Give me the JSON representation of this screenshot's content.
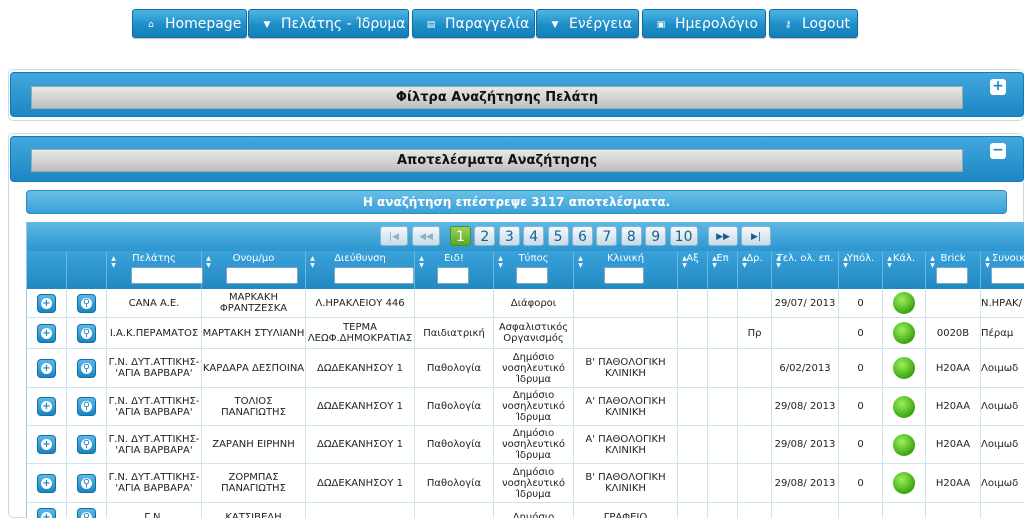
{
  "nav": [
    {
      "label": "Homepage",
      "icon": "home-icon",
      "glyph": "⌂"
    },
    {
      "label": "Πελάτης - Ίδρυμα",
      "icon": "dropdown-arrow-icon",
      "glyph": "▼"
    },
    {
      "label": "Παραγγελία",
      "icon": "list-icon",
      "glyph": "▤"
    },
    {
      "label": "Ενέργεια",
      "icon": "dropdown-arrow-icon",
      "glyph": "▼"
    },
    {
      "label": "Ημερολόγιο",
      "icon": "calendar-icon",
      "glyph": "▣"
    },
    {
      "label": "Logout",
      "icon": "key-icon",
      "glyph": "⚷"
    }
  ],
  "filter_panel": {
    "title": "Φίλτρα Αναζήτησης Πελάτη",
    "toggle": "+"
  },
  "results_panel": {
    "title": "Αποτελέσματα Αναζήτησης",
    "toggle": "−"
  },
  "results_message": "Η αναζήτηση επέστρεψε 3117 αποτελέσματα.",
  "pager": {
    "first": "|◀",
    "prev": "◀◀",
    "pages": [
      "1",
      "2",
      "3",
      "4",
      "5",
      "6",
      "7",
      "8",
      "9",
      "10"
    ],
    "current": "1",
    "next": "▶▶",
    "last": "▶|"
  },
  "columns": [
    "",
    "",
    "Πελάτης",
    "Ονομ/μο",
    "Διεύθυνση",
    "Ειδ!",
    "Τύπος",
    "Κλινική",
    "Αξ",
    "Επ",
    "Δρ.",
    "Τελ. ολ. επ.",
    "Υπόλ.",
    "Κάλ.",
    "Brick",
    "Συνοικ"
  ],
  "rows": [
    {
      "client": "CANA A.E.",
      "name": "ΜΑΡΚΑΚΗ ΦΡΑΝΤΖΕΣΚΑ",
      "address": "Λ.ΗΡΑΚΛΕΙΟΥ 446",
      "specialty": "",
      "type": "Διάφοροι",
      "clinic": "",
      "ax": "",
      "ep": "",
      "dr": "",
      "last_visit": "29/07/ 2013",
      "balance": "0",
      "brick": "",
      "area": "Ν.ΗΡΑΚ/"
    },
    {
      "client": "Ι.Α.Κ.ΠΕΡΑΜΑΤΟΣ",
      "name": "ΜΑΡΤΑΚΗ ΣΤΥΛΙΑΝΗ",
      "address": "ΤΕΡΜΑ ΛΕΩΦ.ΔΗΜΟΚΡΑΤΙΑΣ",
      "specialty": "Παιδιατρική",
      "type": "Ασφαλιστικός Οργανισμός",
      "clinic": "",
      "ax": "",
      "ep": "",
      "dr": "Πρ",
      "last_visit": "",
      "balance": "0",
      "brick": "0020B",
      "area": "Πέραμ"
    },
    {
      "client": "Γ.Ν. ΔΥΤ.ΑΤΤΙΚΗΣ- 'ΑΓΙΑ ΒΑΡΒΑΡΑ'",
      "name": "ΚΑΡΔΑΡΑ ΔΕΣΠΟΙΝΑ",
      "address": "ΔΩΔΕΚΑΝΗΣΟΥ 1",
      "specialty": "Παθολογία",
      "type": "Δημόσιο νοσηλευτικό Ίδρυμα",
      "clinic": "Β' ΠΑΘΟΛΟΓΙΚΗ ΚΛΙΝΙΚΗ",
      "ax": "",
      "ep": "",
      "dr": "",
      "last_visit": "6/02/2013",
      "balance": "0",
      "brick": "H20AA",
      "area": "Λοιμωδ"
    },
    {
      "client": "Γ.Ν. ΔΥΤ.ΑΤΤΙΚΗΣ- 'ΑΓΙΑ ΒΑΡΒΑΡΑ'",
      "name": "ΤΟΛΙΟΣ ΠΑΝΑΓΙΩΤΗΣ",
      "address": "ΔΩΔΕΚΑΝΗΣΟΥ 1",
      "specialty": "Παθολογία",
      "type": "Δημόσιο νοσηλευτικό Ίδρυμα",
      "clinic": "Α' ΠΑΘΟΛΟΓΙΚΗ ΚΛΙΝΙΚΗ",
      "ax": "",
      "ep": "",
      "dr": "",
      "last_visit": "29/08/ 2013",
      "balance": "0",
      "brick": "H20AA",
      "area": "Λοιμωδ"
    },
    {
      "client": "Γ.Ν. ΔΥΤ.ΑΤΤΙΚΗΣ- 'ΑΓΙΑ ΒΑΡΒΑΡΑ'",
      "name": "ΖΑΡΑΝΗ ΕΙΡΗΝΗ",
      "address": "ΔΩΔΕΚΑΝΗΣΟΥ 1",
      "specialty": "Παθολογία",
      "type": "Δημόσιο νοσηλευτικό Ίδρυμα",
      "clinic": "Α' ΠΑΘΟΛΟΓΙΚΗ ΚΛΙΝΙΚΗ",
      "ax": "",
      "ep": "",
      "dr": "",
      "last_visit": "29/08/ 2013",
      "balance": "0",
      "brick": "H20AA",
      "area": "Λοιμωδ"
    },
    {
      "client": "Γ.Ν. ΔΥΤ.ΑΤΤΙΚΗΣ- 'ΑΓΙΑ ΒΑΡΒΑΡΑ'",
      "name": "ΖΟΡΜΠΑΣ ΠΑΝΑΓΙΩΤΗΣ",
      "address": "ΔΩΔΕΚΑΝΗΣΟΥ 1",
      "specialty": "Παθολογία",
      "type": "Δημόσιο νοσηλευτικό Ίδρυμα",
      "clinic": "Β' ΠΑΘΟΛΟΓΙΚΗ ΚΛΙΝΙΚΗ",
      "ax": "",
      "ep": "",
      "dr": "",
      "last_visit": "29/08/ 2013",
      "balance": "0",
      "brick": "H20AA",
      "area": "Λοιμωδ"
    },
    {
      "client": "Γ.Ν.",
      "name": "ΚΑΤΣΙΒΕΛΗ",
      "address": "",
      "specialty": "",
      "type": "Δημόσιο",
      "clinic": "ΓΡΑΦΕΙΟ",
      "ax": "",
      "ep": "",
      "dr": "",
      "last_visit": "",
      "balance": "",
      "brick": "",
      "area": ""
    }
  ],
  "row_actions": {
    "add_icon": "plus-circle-icon",
    "view_icon": "magnifier-icon",
    "add_glyph": "+",
    "view_glyph": "⚲"
  },
  "colors": {
    "accent": "#1b86c4",
    "active_page": "#58a82a",
    "status_ok": "#3aa612"
  }
}
